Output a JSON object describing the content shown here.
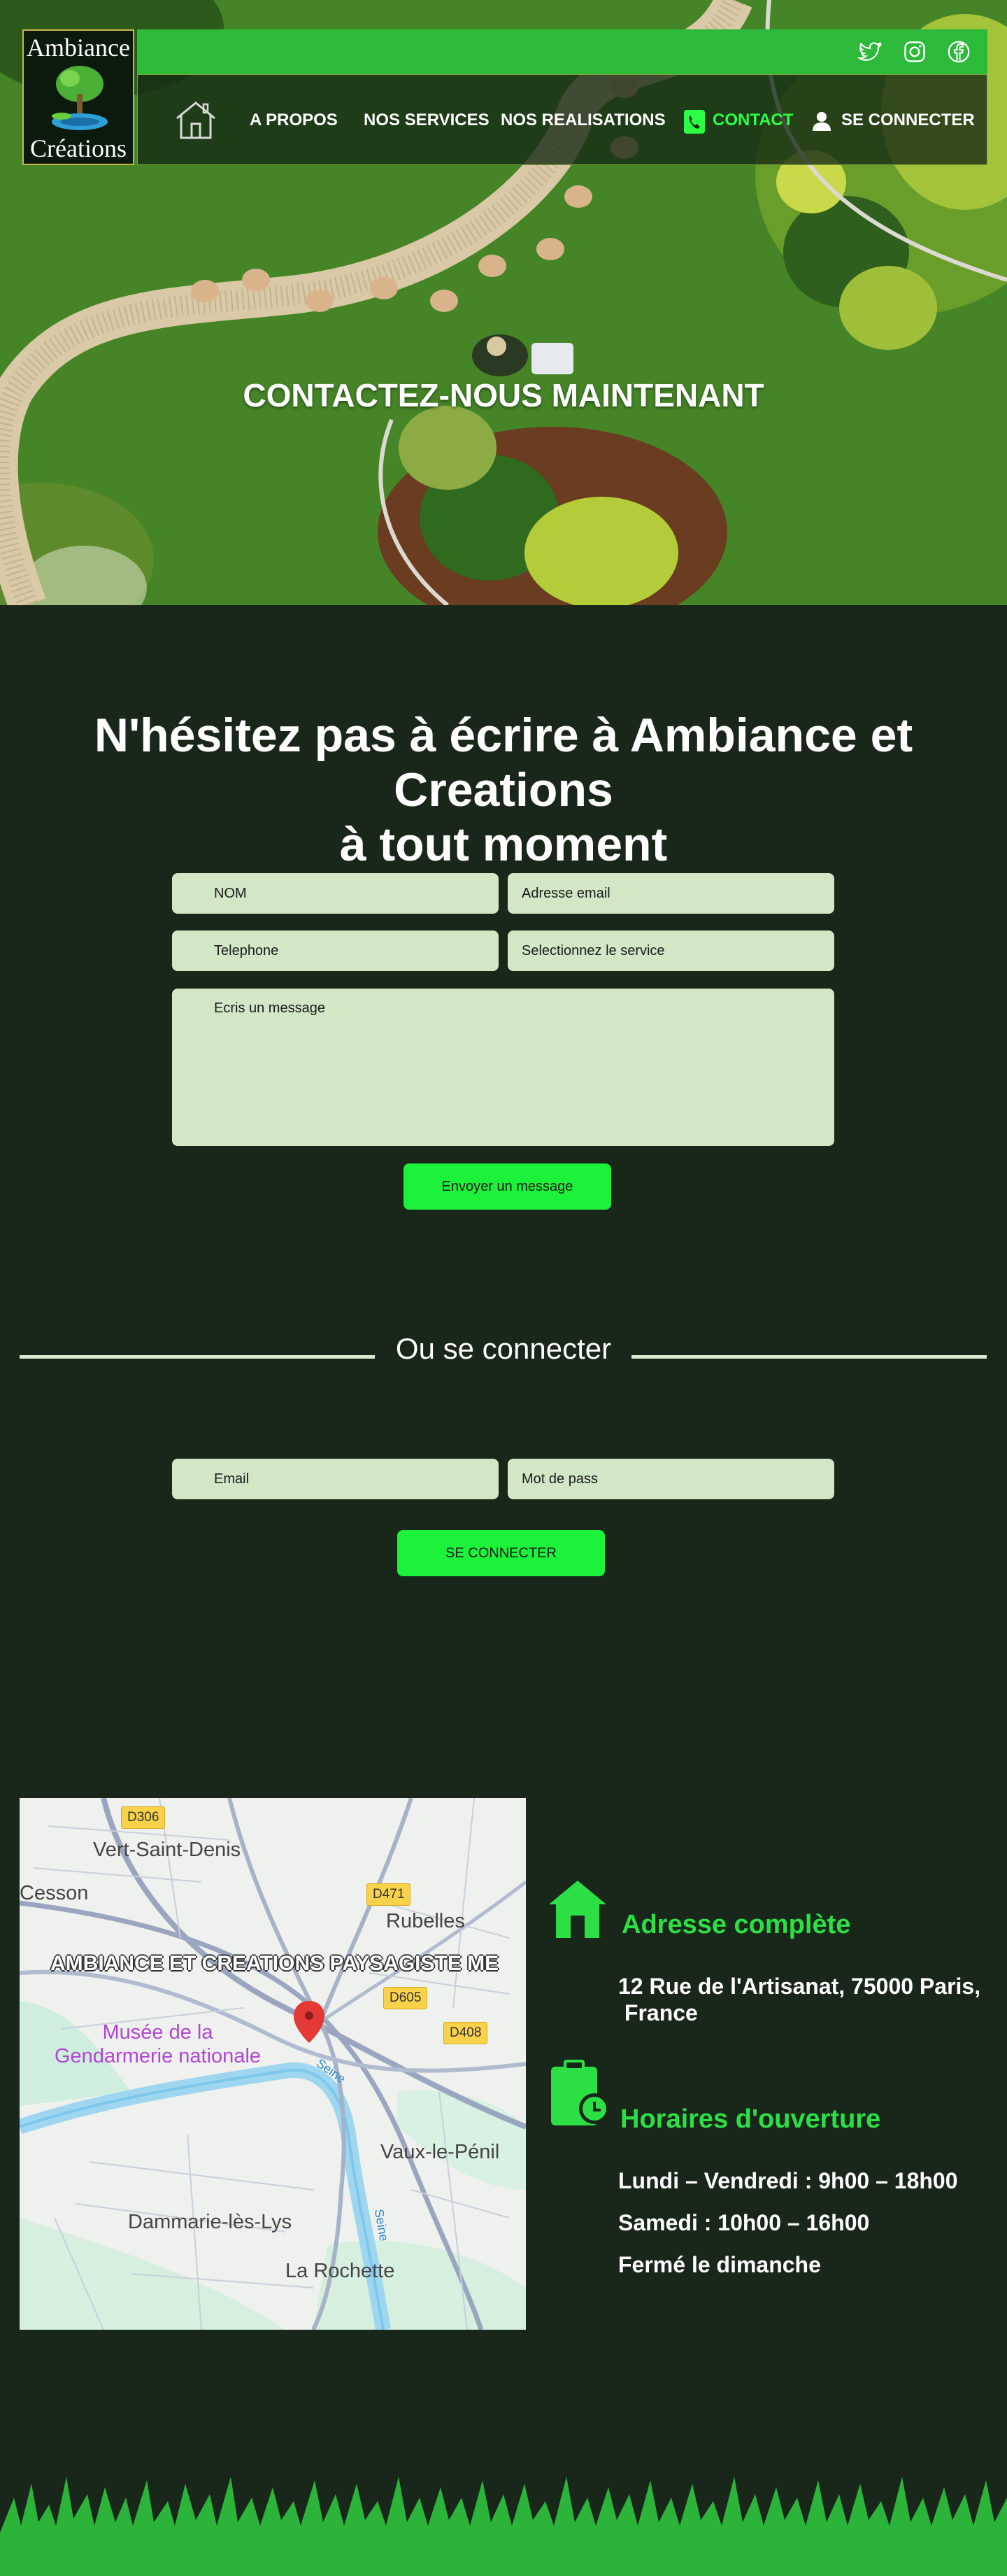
{
  "brand": {
    "line1": "Ambiance",
    "line2": "Créations"
  },
  "social": {
    "icons": [
      "twitter-icon",
      "instagram-icon",
      "facebook-icon"
    ]
  },
  "nav": {
    "home_icon": "house-icon",
    "items": [
      "A PROPOS",
      "NOS SERVICES",
      "NOS REALISATIONS"
    ],
    "contact_label": "CONTACT",
    "login_label": "SE CONNECTER"
  },
  "hero": {
    "title": "CONTACTEZ-NOUS MAINTENANT"
  },
  "contact_form": {
    "heading_line1": "N'hésitez pas à écrire à Ambiance et",
    "heading_line2": "Creations",
    "heading_line3": "à tout moment",
    "name_placeholder": "NOM",
    "email_placeholder": "Adresse email",
    "phone_placeholder": "Telephone",
    "service_placeholder": "Selectionnez le service",
    "message_placeholder": "Ecris un message",
    "submit_label": "Envoyer un message"
  },
  "login": {
    "divider_text": "Ou se connecter",
    "email_placeholder": "Email",
    "password_placeholder": "Mot de pass",
    "submit_label": "SE CONNECTER"
  },
  "map": {
    "towns": [
      "Vert-Saint-Denis",
      "Cesson",
      "Rubelles",
      "Vaux-le-Pénil",
      "Dammarie-lès-Lys",
      "La Rochette"
    ],
    "roads": [
      "D306",
      "D471",
      "D605",
      "D408"
    ],
    "poi_line1": "Musée de la",
    "poi_line2": "Gendarmerie nationale",
    "business": "AMBIANCE ET CREATIONS PAYSAGISTE ME",
    "river1": "Seine",
    "river2": "Seine"
  },
  "address": {
    "title": "Adresse complète",
    "line1": "12 Rue de l'Artisanat, 75000 Paris,",
    "line2": " France"
  },
  "hours": {
    "title": "Horaires d'ouverture",
    "weekdays": "Lundi – Vendredi : 9h00 – 18h00",
    "saturday": "Samedi : 10h00 – 16h00",
    "sunday": "Fermé le dimanche"
  },
  "colors": {
    "background": "#19261a",
    "accent_green": "#2bdf45",
    "bright_green": "#1df23a",
    "topbar_green": "#2dba3a",
    "field_bg": "#d1e7c6"
  }
}
